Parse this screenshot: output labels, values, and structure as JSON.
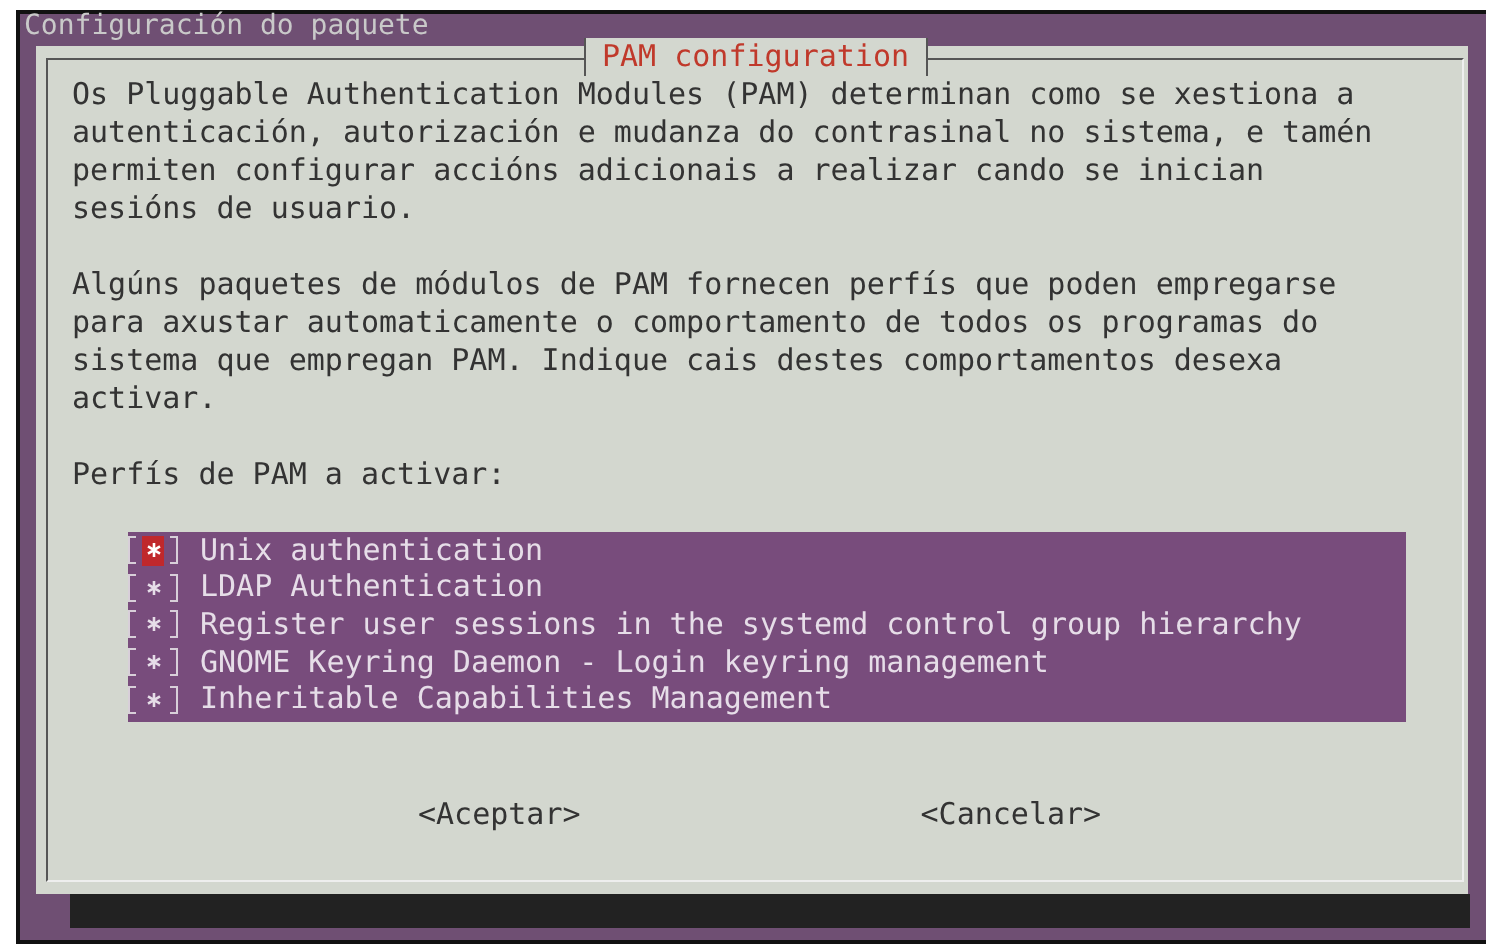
{
  "window": {
    "title": "Configuración do paquete"
  },
  "dialog": {
    "title": "PAM configuration",
    "paragraphs": [
      "Os Pluggable Authentication Modules (PAM) determinan como se xestiona a autenticación, autorización e mudanza do contrasinal no sistema, e tamén permiten configurar accións adicionais a realizar cando se inician sesións de usuario.",
      "Algúns paquetes de módulos de PAM fornecen perfís que poden empregarse para axustar automaticamente o comportamento de todos os programas do sistema que empregan PAM. Indique cais destes comportamentos desexa activar."
    ],
    "list_label": "Perfís de PAM a activar:",
    "options": [
      {
        "label": "Unix authentication",
        "checked": true,
        "selected": true
      },
      {
        "label": "LDAP Authentication",
        "checked": true,
        "selected": false
      },
      {
        "label": "Register user sessions in the systemd control group hierarchy",
        "checked": true,
        "selected": false
      },
      {
        "label": "GNOME Keyring Daemon - Login keyring management",
        "checked": true,
        "selected": false
      },
      {
        "label": "Inheritable Capabilities Management",
        "checked": true,
        "selected": false
      }
    ],
    "buttons": [
      "<Aceptar>",
      "<Cancelar>"
    ]
  }
}
